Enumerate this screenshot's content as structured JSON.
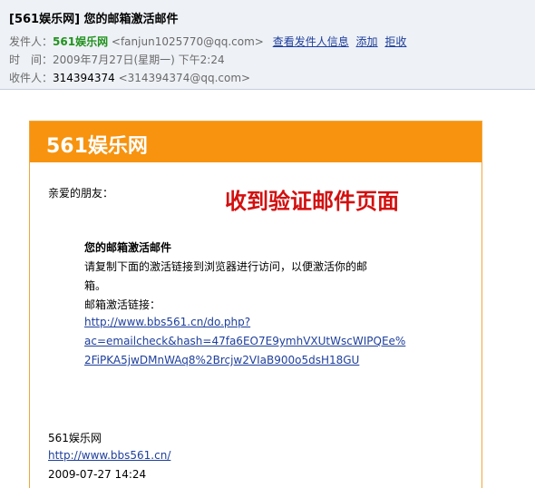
{
  "header": {
    "subject": "[561娱乐网] 您的邮箱激活邮件",
    "from_label": "发件人：",
    "from_name": "561娱乐网",
    "from_email": "<fanjun1025770@qq.com>",
    "actions": [
      "查看发件人信息",
      "添加",
      "拒收"
    ],
    "time_label": "时　间：",
    "time_value": "2009年7月27日(星期一) 下午2:24",
    "to_label": "收件人：",
    "to_name": "314394374",
    "to_email": "<314394374@qq.com>"
  },
  "email": {
    "brand": "561娱乐网",
    "greeting": "亲爱的朋友：",
    "overlay_caption": "收到验证邮件页面",
    "title": "您的邮箱激活邮件",
    "body_line1": "请复制下面的激活链接到浏览器进行访问，以便激活你的邮",
    "body_line2": "箱。",
    "link_label": "邮箱激活链接：",
    "activation_link_lines": [
      "http://www.bbs561.cn/do.php?",
      "ac=emailcheck&hash=47fa6EO7E9ymhVXUtWscWIPQEe%",
      "2FiPKA5jwDMnWAq8%2Brcjw2VIaB900o5dsH18GU"
    ],
    "signature_name": "561娱乐网",
    "signature_url": "http://www.bbs561.cn/",
    "signature_date": "2009-07-27 14:24"
  },
  "colors": {
    "accent_orange": "#f7930f",
    "header_bg": "#eef1f6",
    "link_blue": "#1e3f9c",
    "sender_green": "#22921e",
    "overlay_red": "#d30f0f"
  }
}
